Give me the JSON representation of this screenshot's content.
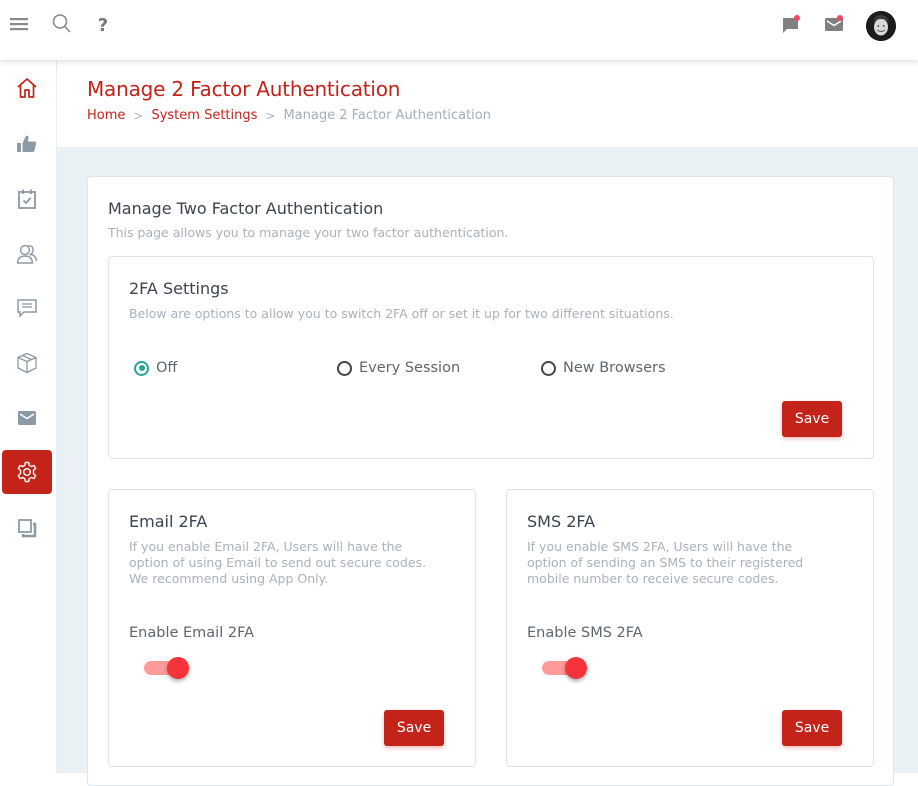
{
  "topbar": {
    "left_icons": [
      "menu-icon",
      "search-icon",
      "help-icon"
    ],
    "help_glyph": "?",
    "right_icons": [
      "chat-icon",
      "mail-icon"
    ],
    "has_notifications": true
  },
  "sidebar": {
    "items": [
      {
        "icon": "home-icon",
        "active": false
      },
      {
        "icon": "thumbs-up-icon",
        "active": false
      },
      {
        "icon": "calendar-check-icon",
        "active": false
      },
      {
        "icon": "users-icon",
        "active": false
      },
      {
        "icon": "message-icon",
        "active": false
      },
      {
        "icon": "box-icon",
        "active": false
      },
      {
        "icon": "mail-icon",
        "active": false
      },
      {
        "icon": "gear-icon",
        "active": true
      },
      {
        "icon": "copy-icon",
        "active": false
      }
    ]
  },
  "header": {
    "title": "Manage 2 Factor Authentication",
    "breadcrumb": {
      "home": "Home",
      "sep": ">",
      "section": "System Settings",
      "current": "Manage 2 Factor Authentication"
    }
  },
  "card": {
    "title": "Manage Two Factor Authentication",
    "subtitle": "This page allows you to manage your two factor authentication."
  },
  "settings": {
    "title": "2FA Settings",
    "subtitle": "Below are options to allow you to switch 2FA off or set it up for two different situations.",
    "options": [
      {
        "label": "Off",
        "checked": true
      },
      {
        "label": "Every Session",
        "checked": false
      },
      {
        "label": "New Browsers",
        "checked": false
      }
    ],
    "save_label": "Save"
  },
  "email2fa": {
    "title": "Email 2FA",
    "desc_lines": [
      "If you enable Email 2FA, Users will have the",
      "option of using Email to send out secure codes.",
      "We recommend using App Only."
    ],
    "toggle_label": "Enable Email 2FA",
    "enabled": true,
    "save_label": "Save"
  },
  "sms2fa": {
    "title": "SMS 2FA",
    "desc_lines": [
      "If you enable SMS 2FA, Users will have the",
      "option of sending an SMS to their registered",
      "mobile number to receive secure codes."
    ],
    "toggle_label": "Enable SMS 2FA",
    "enabled": true,
    "save_label": "Save"
  },
  "colors": {
    "brand": "#c4231a",
    "radio_checked": "#26a69a",
    "toggle_on": "#f5333a",
    "notification": "#f14668"
  }
}
